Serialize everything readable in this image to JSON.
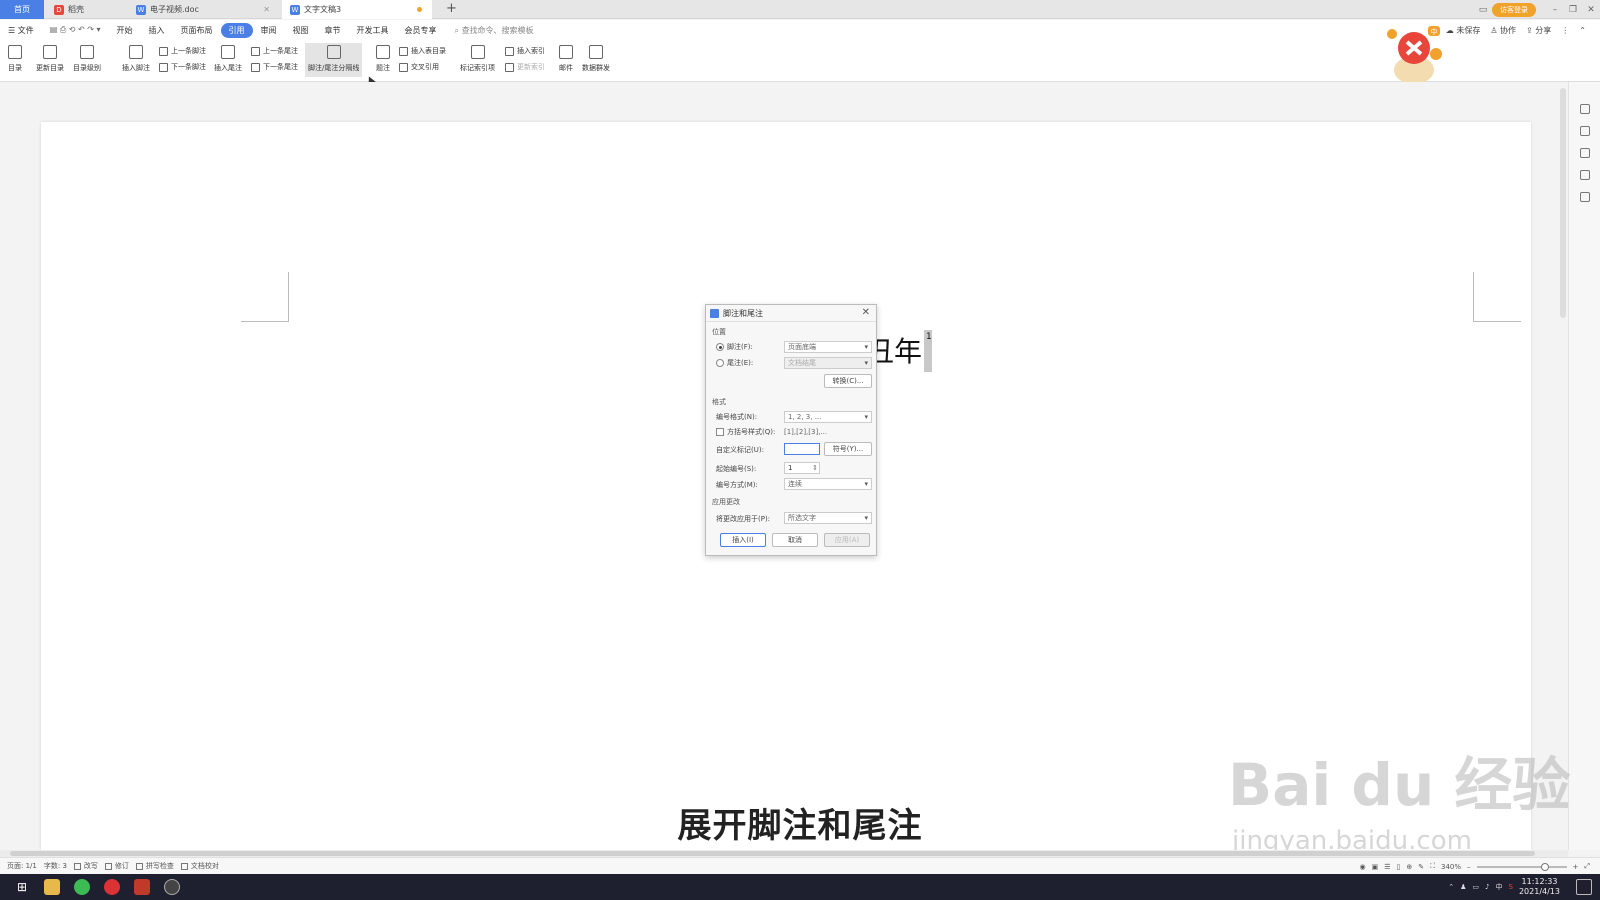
{
  "tabs": {
    "home": "首页",
    "t1": "稻壳",
    "t2": "电子视频.doc",
    "t3": "文字文稿3",
    "add": "+"
  },
  "topright": {
    "login": "访客登录",
    "minimize": "–",
    "restore": "❐",
    "close": "✕"
  },
  "menu": {
    "file": "文件",
    "items": [
      "开始",
      "插入",
      "页面布局",
      "引用",
      "审阅",
      "视图",
      "章节",
      "开发工具",
      "会员专享"
    ],
    "active_index": 3,
    "search": "查找命令、搜索模板",
    "unsaved": "未保存",
    "collab": "协作",
    "share": "分享"
  },
  "ribbon": {
    "toc": "目录",
    "update_toc": "更新目录",
    "toc_level": "目录级别",
    "insert_footnote": "插入脚注",
    "prev_footnote": "上一条脚注",
    "next_footnote": "下一条脚注",
    "insert_endnote": "插入尾注",
    "prev_endnote": "上一条尾注",
    "next_endnote": "下一条尾注",
    "separator": "脚注/尾注分隔线",
    "caption": "题注",
    "insert_table_of_figures": "插入表目录",
    "cross_ref": "交叉引用",
    "mark_citation": "标记索引项",
    "insert_index": "插入索引",
    "update_index": "更新索引",
    "mail": "邮件",
    "data_merge": "数据群发"
  },
  "document": {
    "text": "辛丑年",
    "superscript": "1"
  },
  "dialog": {
    "title": "脚注和尾注",
    "section_position": "位置",
    "footnote_label": "脚注(F):",
    "footnote_value": "页面底端",
    "endnote_label": "尾注(E):",
    "endnote_value": "文档结尾",
    "convert_btn": "转换(C)...",
    "section_format": "格式",
    "number_format_label": "编号格式(N):",
    "number_format_value": "1, 2, 3, ...",
    "bracket_label": "方括号样式(Q):",
    "bracket_value": "[1],[2],[3],...",
    "custom_mark_label": "自定义标记(U):",
    "symbol_btn": "符号(Y)...",
    "start_label": "起始编号(S):",
    "start_value": "1",
    "numbering_label": "编号方式(M):",
    "numbering_value": "连续",
    "section_apply": "应用更改",
    "apply_label": "将更改应用于(P):",
    "apply_value": "所选文字",
    "insert_btn": "插入(I)",
    "cancel_btn": "取消",
    "apply_btn": "应用(A)"
  },
  "subtitle": "展开脚注和尾注",
  "watermark": {
    "brand": "Bai du 经验",
    "url": "jingyan.baidu.com"
  },
  "status": {
    "page": "页面: 1/1",
    "words": "字数: 3",
    "rewrite": "改写",
    "track": "修订",
    "spell": "拼写检查",
    "proof": "文档校对",
    "zoom": "340%",
    "zoom_minus": "–",
    "zoom_plus": "+"
  },
  "taskbar": {
    "ime": "中",
    "time": "11:12:33",
    "date": "2021/4/13"
  },
  "colors": {
    "accent": "#4a7fe6",
    "login": "#f1a22a"
  }
}
